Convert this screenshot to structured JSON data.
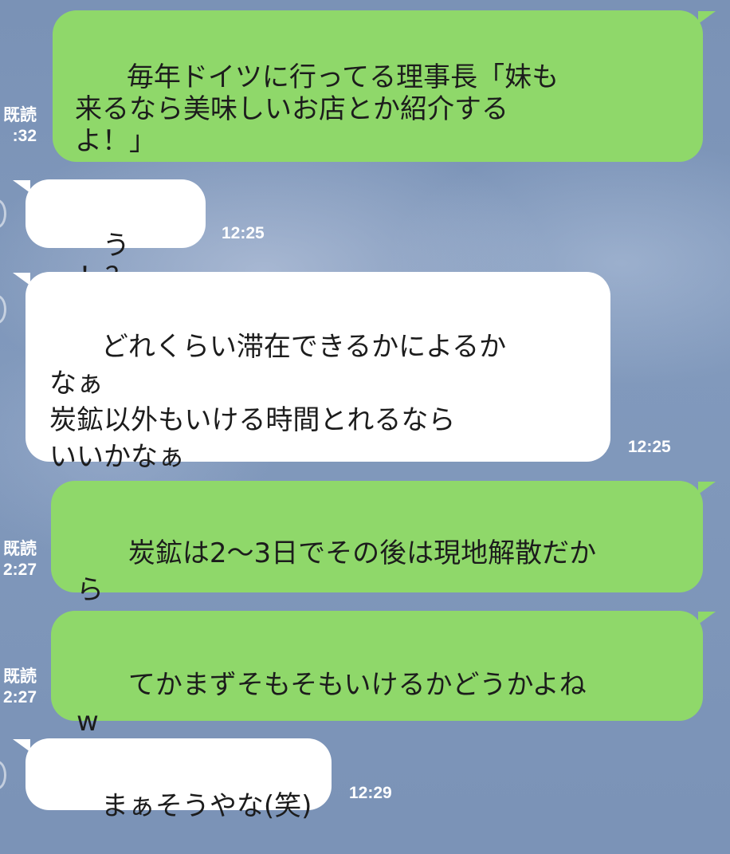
{
  "chat": {
    "messages": [
      {
        "sender": "me",
        "text": "毎年ドイツに行ってる理事長「妹も\n来るなら美味しいお店とか紹介する\nよ！」",
        "read_label": "既読",
        "time": ":32"
      },
      {
        "sender": "other",
        "text": "うっ！？",
        "time": "12:25"
      },
      {
        "sender": "other",
        "text": "どれくらい滞在できるかによるか\nなぁ\n炭鉱以外もいける時間とれるなら\nいいかなぁ",
        "time": "12:25"
      },
      {
        "sender": "me",
        "text": "炭鉱は2〜3日でその後は現地解散だか\nら",
        "read_label": "既読",
        "time": "2:27"
      },
      {
        "sender": "me",
        "text": "てかまずそもそもいけるかどうかよね\nw",
        "read_label": "既読",
        "time": "2:27"
      },
      {
        "sender": "other",
        "text": "まぁそうやな(笑)",
        "time": "12:29"
      }
    ]
  },
  "colors": {
    "background": "#7b93b7",
    "sent_bubble": "#8fd86a",
    "received_bubble": "#ffffff",
    "meta_text": "#ffffff"
  }
}
